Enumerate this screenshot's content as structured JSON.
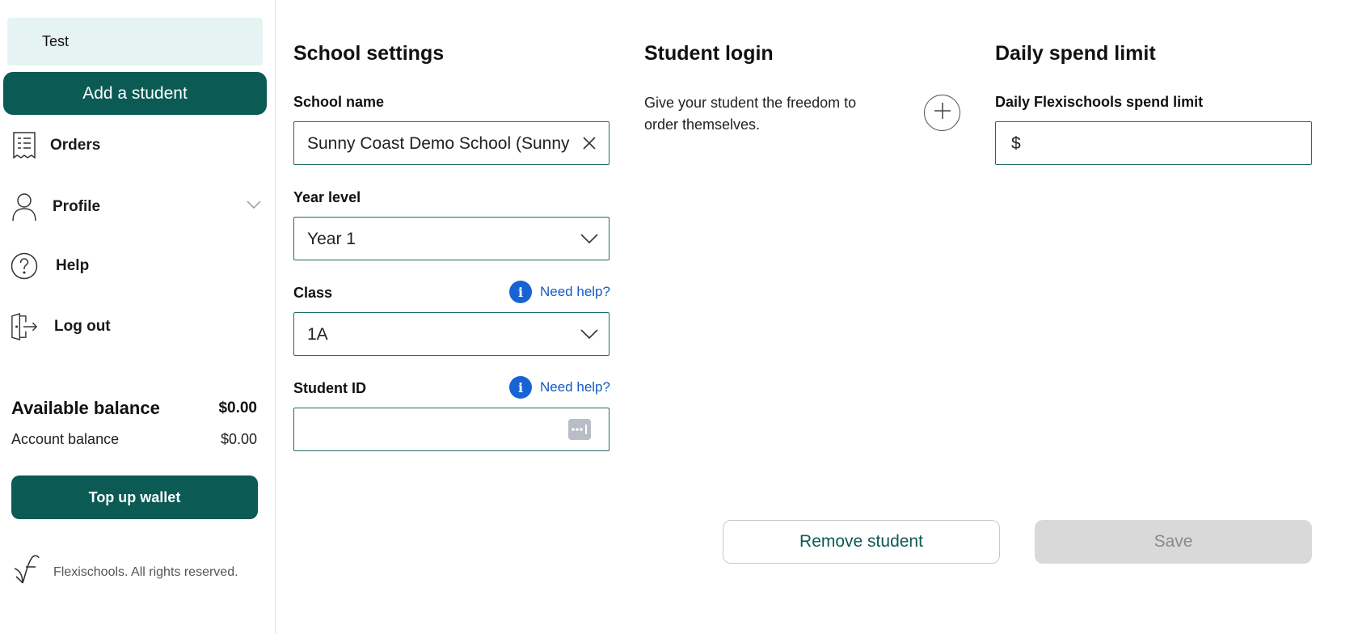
{
  "sidebar": {
    "student_name": "Test",
    "add_student_label": "Add a student",
    "nav": {
      "orders": "Orders",
      "profile": "Profile",
      "help": "Help",
      "logout": "Log out"
    },
    "balances": {
      "available_label": "Available balance",
      "available_value": "$0.00",
      "account_label": "Account balance",
      "account_value": "$0.00"
    },
    "topup_label": "Top up wallet",
    "footer_text": "Flexischools. All rights reserved."
  },
  "school_settings": {
    "title": "School settings",
    "school_name_label": "School name",
    "school_name_value": "Sunny Coast Demo School (Sunny Coast)",
    "year_level_label": "Year level",
    "year_level_value": "Year 1",
    "class_label": "Class",
    "class_value": "1A",
    "student_id_label": "Student ID",
    "student_id_value": "",
    "need_help_label": "Need help?"
  },
  "student_login": {
    "title": "Student login",
    "description": "Give your student the freedom to order themselves."
  },
  "daily_spend": {
    "title": "Daily spend limit",
    "field_label": "Daily Flexischools spend limit",
    "currency_symbol": "$",
    "value": ""
  },
  "actions": {
    "remove_label": "Remove student",
    "save_label": "Save"
  },
  "colors": {
    "brand": "#0b5a54",
    "chip_bg": "#e5f4f2",
    "link": "#1658c4",
    "info_icon": "#1763d4",
    "disabled": "#d9d9d9"
  }
}
